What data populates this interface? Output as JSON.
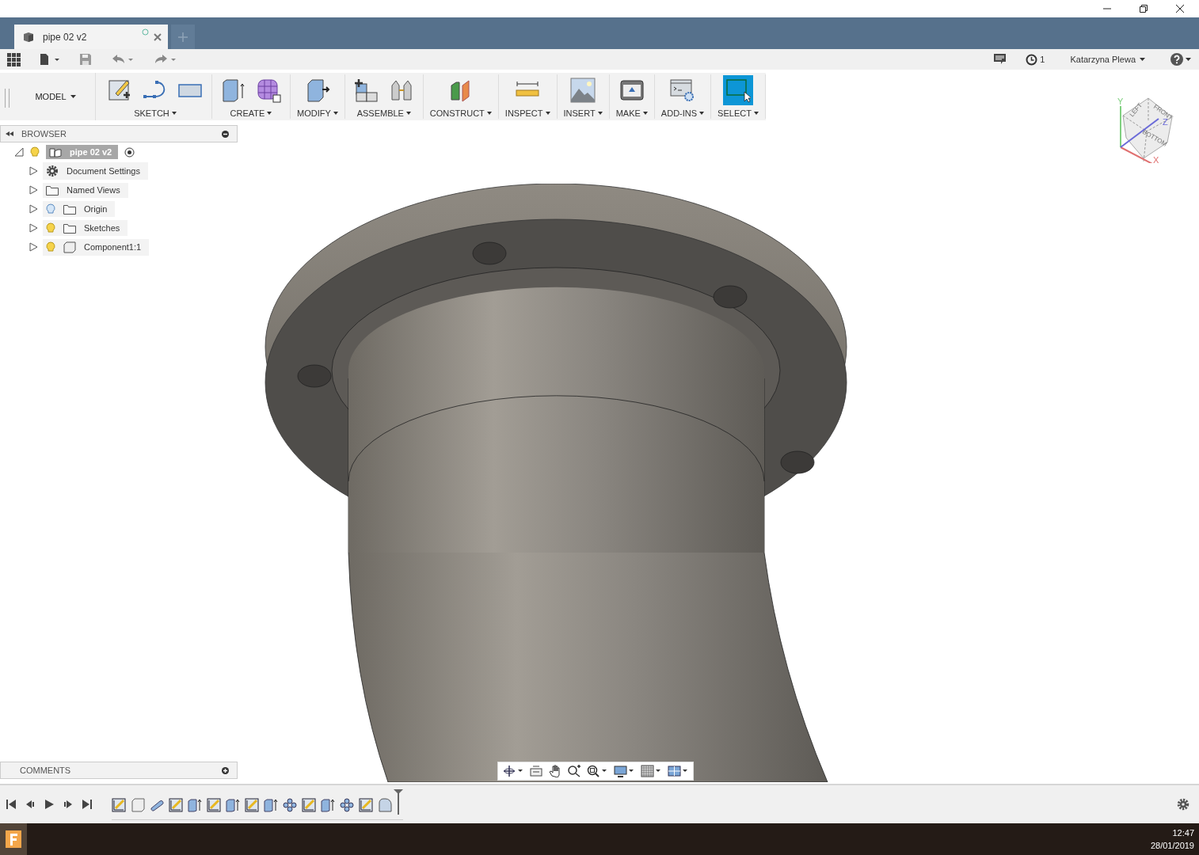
{
  "tabs": [
    {
      "title": "pipe 02 v2",
      "selected": true
    }
  ],
  "quick_access": {
    "jobs": "1",
    "user": "Katarzyna Plewa"
  },
  "toolbar": {
    "workspace": "MODEL",
    "groups": [
      {
        "label": "SKETCH",
        "tools": [
          {
            "kind": "sketch",
            "selected": false
          },
          {
            "kind": "spline",
            "selected": false
          },
          {
            "kind": "rectangle",
            "selected": false
          }
        ]
      },
      {
        "label": "CREATE",
        "tools": [
          {
            "kind": "extrude",
            "selected": false
          },
          {
            "kind": "form",
            "selected": false
          }
        ]
      },
      {
        "label": "MODIFY",
        "tools": [
          {
            "kind": "press",
            "selected": false
          }
        ]
      },
      {
        "label": "ASSEMBLE",
        "tools": [
          {
            "kind": "component",
            "selected": false
          },
          {
            "kind": "joint",
            "selected": false
          }
        ]
      },
      {
        "label": "CONSTRUCT",
        "tools": [
          {
            "kind": "plane",
            "selected": false
          }
        ]
      },
      {
        "label": "INSPECT",
        "tools": [
          {
            "kind": "measure",
            "selected": false
          }
        ]
      },
      {
        "label": "INSERT",
        "tools": [
          {
            "kind": "image",
            "selected": false
          }
        ]
      },
      {
        "label": "MAKE",
        "tools": [
          {
            "kind": "print",
            "selected": false
          }
        ]
      },
      {
        "label": "ADD-INS",
        "tools": [
          {
            "kind": "script",
            "selected": false
          }
        ]
      },
      {
        "label": "SELECT",
        "tools": [
          {
            "kind": "select",
            "selected": true
          }
        ]
      }
    ]
  },
  "browser": {
    "title": "BROWSER",
    "root": {
      "label": "pipe 02 v2",
      "visible": true,
      "expanded": true,
      "children": [
        {
          "kind": "settings",
          "label": "Document Settings",
          "expanded": false
        },
        {
          "kind": "folder",
          "label": "Named Views",
          "expanded": false
        },
        {
          "kind": "folder",
          "label": "Origin",
          "visible": false,
          "expanded": false
        },
        {
          "kind": "folder",
          "label": "Sketches",
          "visible": true,
          "expanded": false
        },
        {
          "kind": "component",
          "label": "Component1:1",
          "visible": true,
          "expanded": false
        }
      ]
    }
  },
  "comments": {
    "title": "COMMENTS"
  },
  "viewcube": {
    "faces": [
      "LEFT",
      "FRONT",
      "BOTTOM"
    ],
    "axes": [
      "X",
      "Y",
      "Z"
    ]
  },
  "timeline": {
    "steps": [
      {
        "kind": "sketch"
      },
      {
        "kind": "body"
      },
      {
        "kind": "pipe"
      },
      {
        "kind": "sketch"
      },
      {
        "kind": "extrude"
      },
      {
        "kind": "sketch"
      },
      {
        "kind": "extrude"
      },
      {
        "kind": "sketch"
      },
      {
        "kind": "extrude"
      },
      {
        "kind": "joint"
      },
      {
        "kind": "sketch"
      },
      {
        "kind": "extrude"
      },
      {
        "kind": "joint"
      },
      {
        "kind": "sketch"
      },
      {
        "kind": "fillet"
      }
    ]
  },
  "taskbar": {
    "time": "12:47",
    "date": "28/01/2019"
  }
}
